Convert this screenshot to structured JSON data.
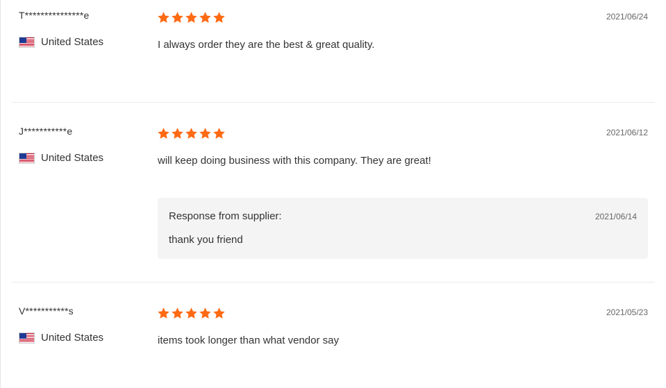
{
  "colors": {
    "star": "#ff6a13",
    "divider": "#ebebeb",
    "response_bg": "#f4f4f4"
  },
  "reviews": [
    {
      "name": "T***************e",
      "country": "United States",
      "flag_icon": "us-flag-icon",
      "rating": 5,
      "date": "2021/06/24",
      "text": "I always order they are the best & great quality."
    },
    {
      "name": "J***********e",
      "country": "United States",
      "flag_icon": "us-flag-icon",
      "rating": 5,
      "date": "2021/06/12",
      "text": "will keep doing business with this company. They are great!",
      "response": {
        "title": "Response from supplier:",
        "date": "2021/06/14",
        "text": "thank you friend"
      }
    },
    {
      "name": "V***********s",
      "country": "United States",
      "flag_icon": "us-flag-icon",
      "rating": 5,
      "date": "2021/05/23",
      "text": "items took longer than what vendor say"
    }
  ]
}
